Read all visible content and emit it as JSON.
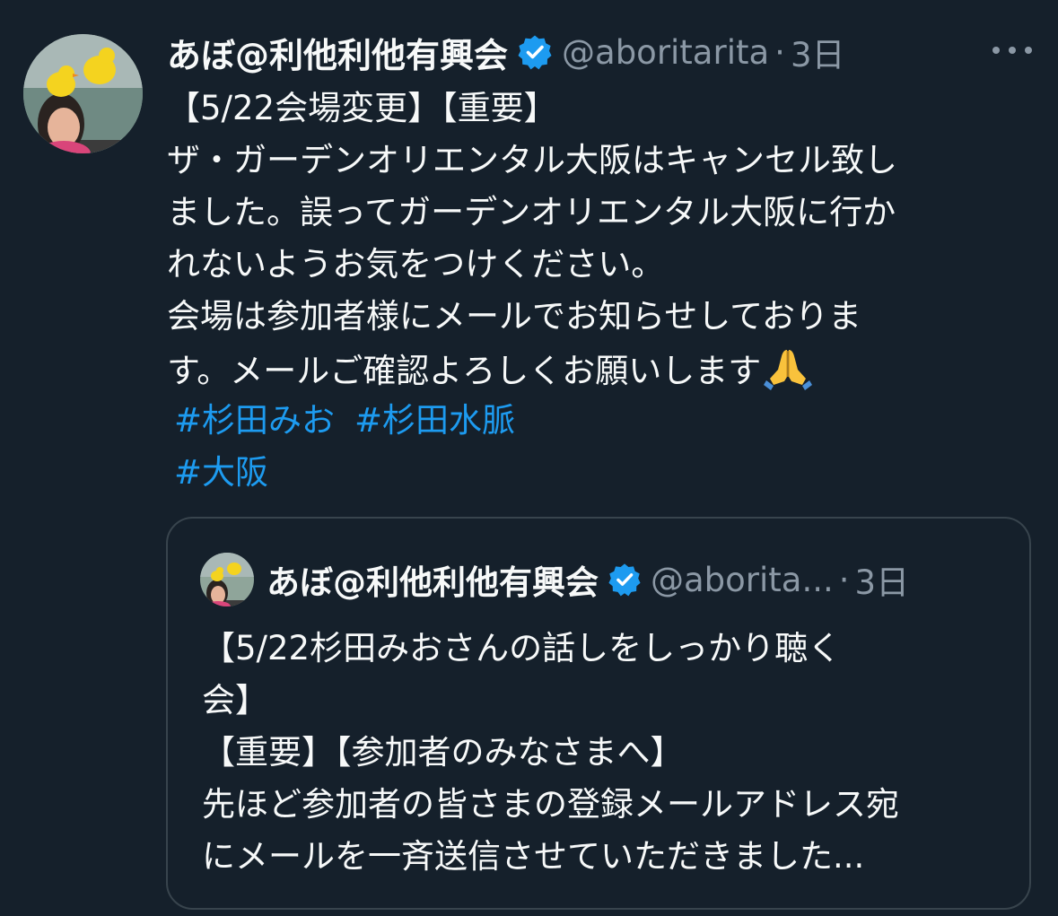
{
  "tweet": {
    "display_name": "あぼ@利他利他有興会",
    "handle": "@aboritarita",
    "separator": "·",
    "time": "3日",
    "lines": [
      "【5/22会場変更】【重要】",
      "ザ・ガーデンオリエンタル大阪はキャンセル致し",
      "ました。誤ってガーデンオリエンタル大阪に行か",
      "れないようお気をつけください。",
      "会場は参加者様にメールでお知らせしておりま",
      "す。メールご確認よろしくお願いします"
    ],
    "emoji": "folded-hands",
    "hashtags": [
      "#杉田みお",
      "#杉田水脈",
      "#大阪"
    ]
  },
  "quote": {
    "display_name": "あぼ@利他利他有興会",
    "handle": "@aborita...",
    "separator": "·",
    "time": "3日",
    "lines": [
      "【5/22杉田みおさんの話しをしっかり聴く",
      "会】",
      "【重要】【参加者のみなさまへ】",
      "先ほど参加者の皆さまの登録メールアドレス宛",
      "にメールを一斉送信させていただきました..."
    ]
  },
  "icons": {
    "verified": "verified-badge-icon",
    "more": "more-horizontal-icon"
  },
  "colors": {
    "background": "#15202b",
    "text": "#f7f9f9",
    "secondary": "#8b98a5",
    "link": "#1d9bf0",
    "verified": "#1d9bf0",
    "border": "#38444d"
  }
}
